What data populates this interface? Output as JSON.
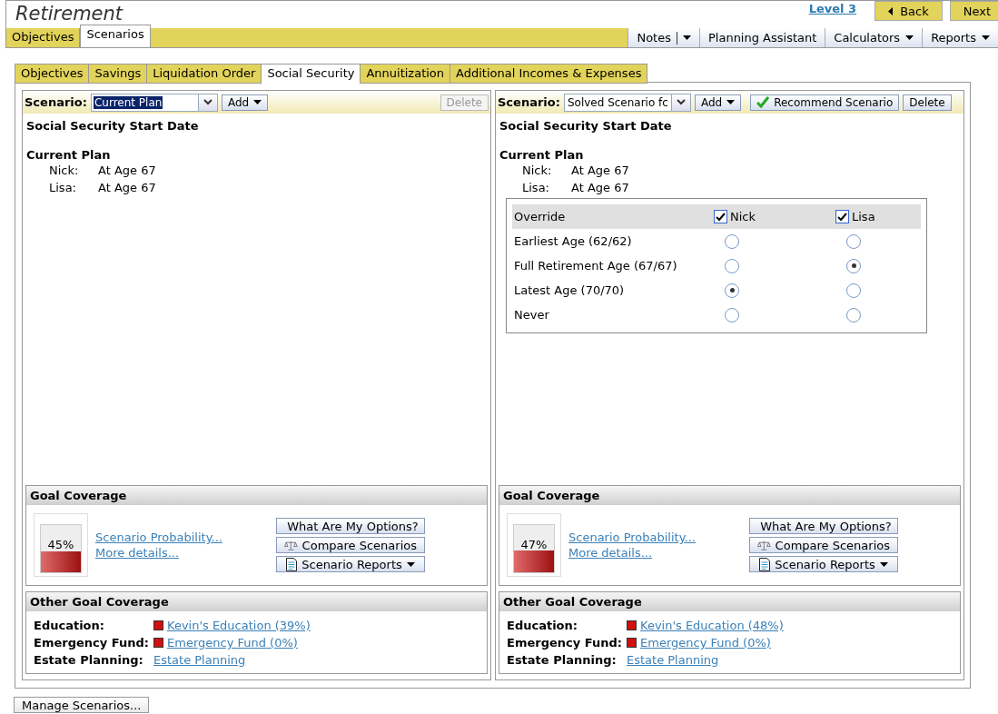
{
  "window": {
    "title": "Retirement"
  },
  "nav": {
    "level_link": "Level 3",
    "back": "Back",
    "next": "Next"
  },
  "main_tabs": [
    {
      "label": "Objectives",
      "selected": false
    },
    {
      "label": "Scenarios",
      "selected": true
    }
  ],
  "toolbar": [
    {
      "label": "Notes",
      "kind": "split"
    },
    {
      "label": "Planning Assistant",
      "kind": "plain"
    },
    {
      "label": "Calculators",
      "kind": "menu"
    },
    {
      "label": "Reports",
      "kind": "menu"
    }
  ],
  "sub_tabs": [
    {
      "label": "Objectives",
      "selected": false
    },
    {
      "label": "Savings",
      "selected": false
    },
    {
      "label": "Liquidation Order",
      "selected": false
    },
    {
      "label": "Social Security",
      "selected": true
    },
    {
      "label": "Annuitization",
      "selected": false
    },
    {
      "label": "Additional Incomes & Expenses",
      "selected": false
    }
  ],
  "panes": [
    {
      "scenario_label": "Scenario:",
      "scenario_value": "Current Plan",
      "highlighted": true,
      "add": "Add",
      "delete": {
        "label": "Delete",
        "disabled": true
      },
      "heading": "Social Security Start Date",
      "plan_title": "Current Plan",
      "plan": [
        {
          "name": "Nick:",
          "value": "At Age 67"
        },
        {
          "name": "Lisa:",
          "value": "At Age 67"
        }
      ],
      "goal_coverage": {
        "title": "Goal Coverage",
        "level": 0.45,
        "reading": "45%",
        "links": [
          "Scenario Probability...",
          "More details..."
        ],
        "buttons": [
          {
            "label": "What Are My Options?",
            "kind": "options"
          },
          {
            "label": "Compare Scenarios",
            "kind": "compare"
          },
          {
            "label": "Scenario Reports",
            "kind": "reports"
          }
        ]
      },
      "other_coverage": {
        "title": "Other Goal Coverage",
        "rows": [
          {
            "label": "Education:",
            "link": "Kevin's Education (39%)",
            "color": "#d01010"
          },
          {
            "label": "Emergency Fund:",
            "link": "Emergency Fund (0%)",
            "color": "#d01010"
          },
          {
            "label": "Estate Planning:",
            "link": "Estate Planning"
          }
        ]
      }
    },
    {
      "scenario_label": "Scenario:",
      "scenario_value": "Solved Scenario fc",
      "highlighted": false,
      "add": "Add",
      "recommend": "Recommend Scenario",
      "delete": {
        "label": "Delete",
        "disabled": false
      },
      "heading": "Social Security Start Date",
      "plan_title": "Current Plan",
      "plan": [
        {
          "name": "Nick:",
          "value": "At Age 67"
        },
        {
          "name": "Lisa:",
          "value": "At Age 67"
        }
      ],
      "override": {
        "title": "Override",
        "people": [
          {
            "name": "Nick",
            "checked": true
          },
          {
            "name": "Lisa",
            "checked": true
          }
        ],
        "rows": [
          {
            "label": "Earliest Age (62/62)",
            "choices": [
              {
                "selected": false
              },
              {
                "selected": false
              }
            ]
          },
          {
            "label": "Full Retirement Age (67/67)",
            "choices": [
              {
                "selected": false
              },
              {
                "selected": true
              }
            ]
          },
          {
            "label": "Latest Age (70/70)",
            "choices": [
              {
                "selected": true
              },
              {
                "selected": false
              }
            ]
          },
          {
            "label": "Never",
            "choices": [
              {
                "selected": false
              },
              {
                "selected": false
              }
            ]
          }
        ]
      },
      "goal_coverage": {
        "title": "Goal Coverage",
        "level": 0.47,
        "reading": "47%",
        "links": [
          "Scenario Probability...",
          "More details..."
        ],
        "buttons": [
          {
            "label": "What Are My Options?",
            "kind": "options"
          },
          {
            "label": "Compare Scenarios",
            "kind": "compare"
          },
          {
            "label": "Scenario Reports",
            "kind": "reports"
          }
        ]
      },
      "other_coverage": {
        "title": "Other Goal Coverage",
        "rows": [
          {
            "label": "Education:",
            "link": "Kevin's Education (48%)",
            "color": "#d01010"
          },
          {
            "label": "Emergency Fund:",
            "link": "Emergency Fund (0%)",
            "color": "#d01010"
          },
          {
            "label": "Estate Planning:",
            "link": "Estate Planning"
          }
        ]
      }
    }
  ],
  "footer_button": "Manage Scenarios..."
}
